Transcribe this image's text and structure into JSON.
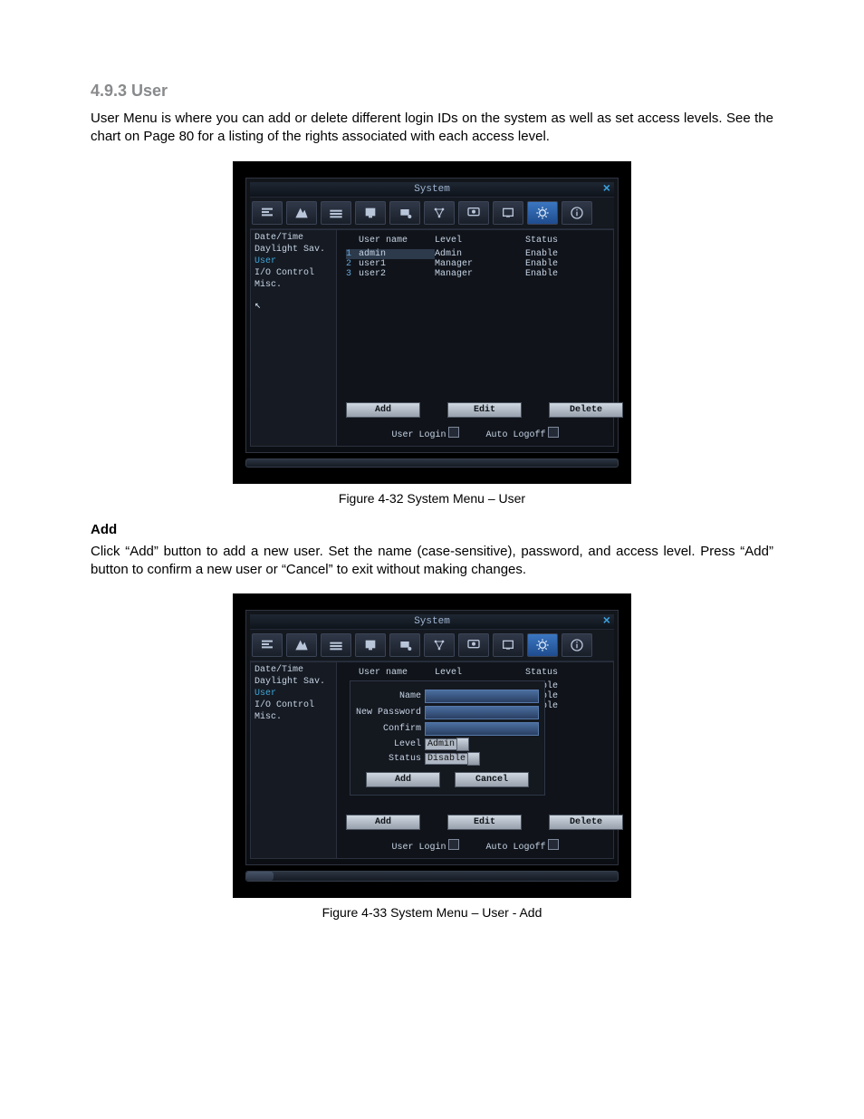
{
  "heading": "4.9.3 User",
  "para1": "User Menu is where you can add or delete different login IDs on the system as well as set access levels. See the chart on Page 80 for a listing of the rights associated with each access level.",
  "fig1_caption": "Figure 4-32 System Menu – User",
  "subhead_add": "Add",
  "para2": "Click “Add” button to add a new user. Set the name (case-sensitive), password, and access level. Press “Add” button to confirm a new user or “Cancel” to exit without making changes.",
  "fig2_caption": "Figure 4-33 System Menu – User - Add",
  "sys": {
    "title": "System",
    "sidebar": [
      "Date/Time",
      "Daylight Sav.",
      "User",
      "I/O Control",
      "Misc."
    ],
    "columns": {
      "c2": "User name",
      "c3": "Level",
      "c4": "Status"
    },
    "rows": [
      {
        "n": "1",
        "user": "admin",
        "level": "Admin",
        "status": "Enable"
      },
      {
        "n": "2",
        "user": "user1",
        "level": "Manager",
        "status": "Enable"
      },
      {
        "n": "3",
        "user": "user2",
        "level": "Manager",
        "status": "Enable"
      }
    ],
    "btn_add": "Add",
    "btn_edit": "Edit",
    "btn_delete": "Delete",
    "user_login": "User Login",
    "auto_logoff": "Auto Logoff"
  },
  "dlg": {
    "name": "Name",
    "newpw": "New Password",
    "confirm": "Confirm",
    "level": "Level",
    "level_val": "Admin",
    "status": "Status",
    "status_val": "Disable",
    "add": "Add",
    "cancel": "Cancel"
  }
}
